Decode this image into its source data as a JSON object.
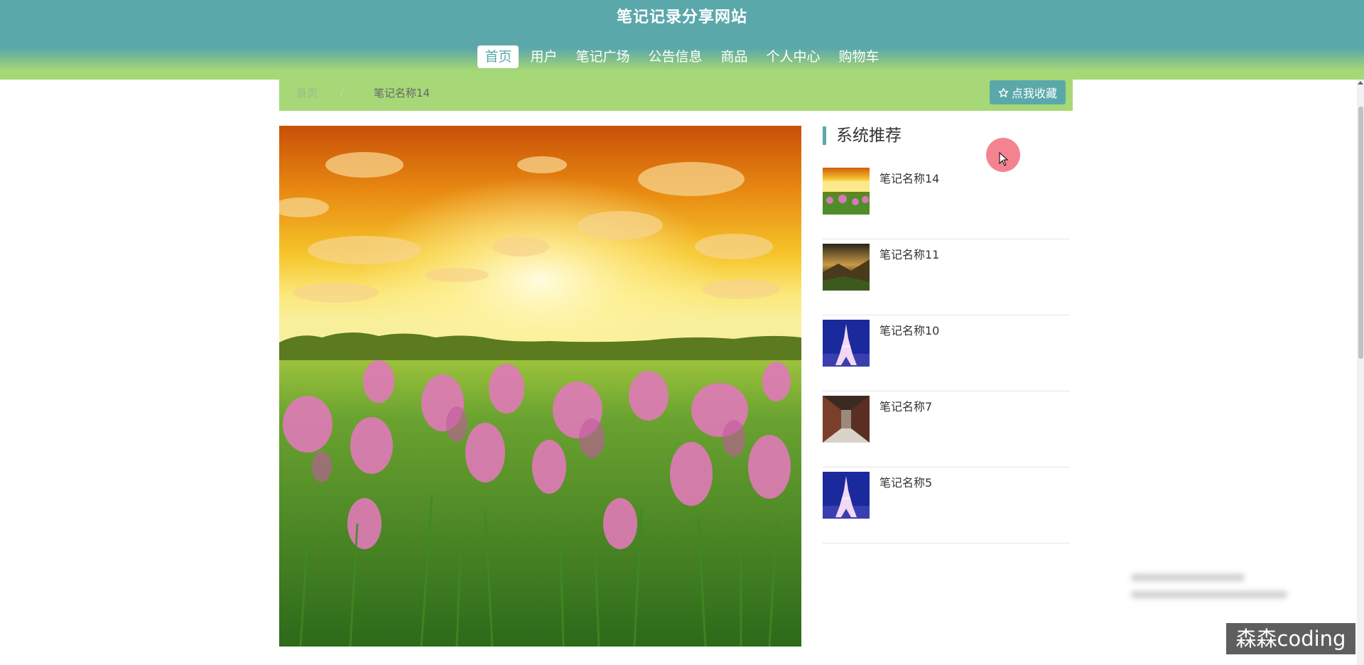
{
  "header": {
    "site_title": "笔记记录分享网站",
    "nav": [
      {
        "label": "首页",
        "active": true
      },
      {
        "label": "用户"
      },
      {
        "label": "笔记广场"
      },
      {
        "label": "公告信息"
      },
      {
        "label": "商品"
      },
      {
        "label": "个人中心"
      },
      {
        "label": "购物车"
      }
    ]
  },
  "breadcrumb": {
    "home": "首页",
    "separator": "/",
    "current": "笔记名称14"
  },
  "favorite_button": {
    "label": "点我收藏",
    "icon": "star-outline-icon"
  },
  "main_image": {
    "description_icon": "flower-field-sunset-image"
  },
  "sidebar": {
    "title": "系统推荐",
    "items": [
      {
        "name": "笔记名称14",
        "thumb": "sunset-field"
      },
      {
        "name": "笔记名称11",
        "thumb": "mountain-dusk"
      },
      {
        "name": "笔记名称10",
        "thumb": "eiffel-tower"
      },
      {
        "name": "笔记名称7",
        "thumb": "corridor"
      },
      {
        "name": "笔记名称5",
        "thumb": "eiffel-tower"
      }
    ]
  },
  "watermark": "森森coding",
  "colors": {
    "teal": "#5ba8ab",
    "green": "#a6d877",
    "accent_cursor": "#f05a6e"
  }
}
